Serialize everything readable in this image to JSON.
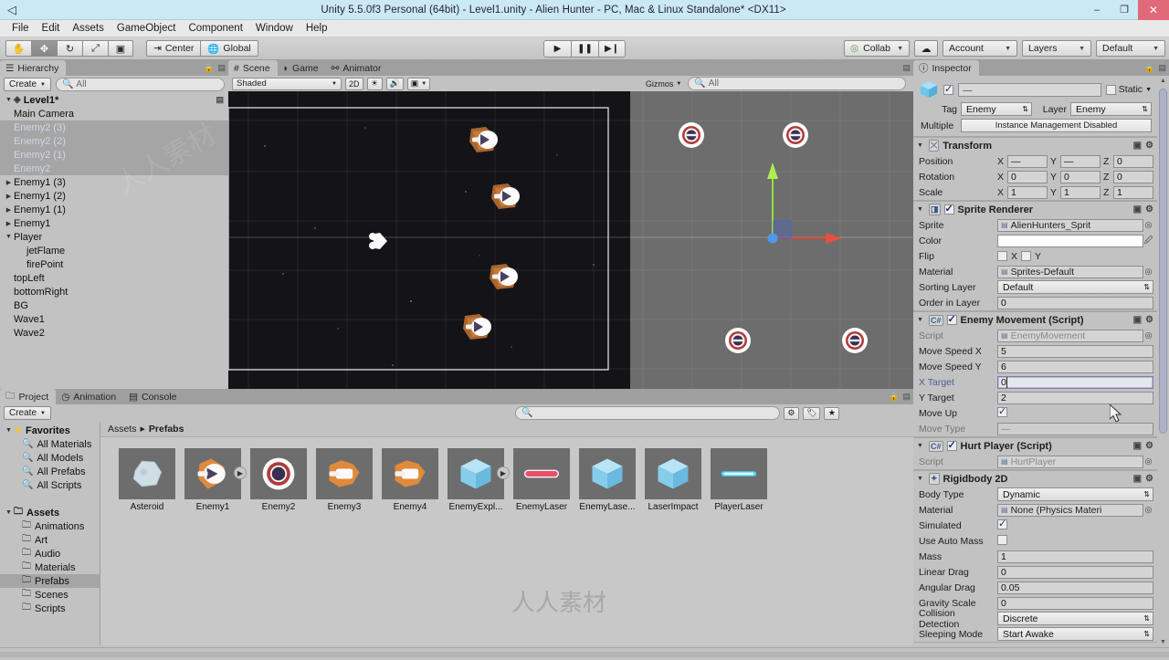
{
  "titlebar": {
    "title": "Unity 5.5.0f3 Personal (64bit) - Level1.unity - Alien Hunter - PC, Mac & Linux Standalone* <DX11>",
    "logo_icon": "unity-logo-icon",
    "minimize": "–",
    "maximize": "❐",
    "close": "✕"
  },
  "menubar": {
    "items": [
      "File",
      "Edit",
      "Assets",
      "GameObject",
      "Component",
      "Window",
      "Help"
    ]
  },
  "toolbar": {
    "transform_tools": [
      {
        "name": "hand-tool",
        "glyph": "✋",
        "active": false
      },
      {
        "name": "move-tool",
        "glyph": "✥",
        "active": true
      },
      {
        "name": "rotate-tool",
        "glyph": "↻",
        "active": false
      },
      {
        "name": "scale-tool",
        "glyph": "⤢",
        "active": false
      },
      {
        "name": "rect-tool",
        "glyph": "▣",
        "active": false
      }
    ],
    "pivot_label": "Center",
    "pivot_icon": "pivot-icon",
    "handle_label": "Global",
    "handle_icon": "globe-icon",
    "play": "▶",
    "pause": "❚❚",
    "step": "▶❙",
    "collab_label": "Collab",
    "collab_icon": "collab-check-icon",
    "cloud_icon": "cloud-icon",
    "account_label": "Account",
    "layers_label": "Layers",
    "layout_label": "Default"
  },
  "hierarchy": {
    "tab": "Hierarchy",
    "tab_icon": "hierarchy-icon",
    "create_label": "Create",
    "search_placeholder": "All",
    "search_icon": "search-icon",
    "scene_name": "Level1*",
    "items": [
      {
        "label": "Main Camera",
        "depth": 1,
        "arrow": "",
        "selected": false,
        "dim": false
      },
      {
        "label": "Enemy2 (3)",
        "depth": 1,
        "arrow": "",
        "selected": true,
        "dim": true
      },
      {
        "label": "Enemy2 (2)",
        "depth": 1,
        "arrow": "",
        "selected": true,
        "dim": true
      },
      {
        "label": "Enemy2 (1)",
        "depth": 1,
        "arrow": "",
        "selected": true,
        "dim": true
      },
      {
        "label": "Enemy2",
        "depth": 1,
        "arrow": "",
        "selected": true,
        "dim": true
      },
      {
        "label": "Enemy1 (3)",
        "depth": 1,
        "arrow": "▶",
        "selected": false,
        "dim": false
      },
      {
        "label": "Enemy1 (2)",
        "depth": 1,
        "arrow": "▶",
        "selected": false,
        "dim": false
      },
      {
        "label": "Enemy1 (1)",
        "depth": 1,
        "arrow": "▶",
        "selected": false,
        "dim": false
      },
      {
        "label": "Enemy1",
        "depth": 1,
        "arrow": "▶",
        "selected": false,
        "dim": false
      },
      {
        "label": "Player",
        "depth": 1,
        "arrow": "▼",
        "selected": false,
        "dim": false
      },
      {
        "label": "jetFlame",
        "depth": 2,
        "arrow": "",
        "selected": false,
        "dim": false
      },
      {
        "label": "firePoint",
        "depth": 2,
        "arrow": "",
        "selected": false,
        "dim": false
      },
      {
        "label": "topLeft",
        "depth": 1,
        "arrow": "",
        "selected": false,
        "dim": false
      },
      {
        "label": "bottomRight",
        "depth": 1,
        "arrow": "",
        "selected": false,
        "dim": false
      },
      {
        "label": "BG",
        "depth": 1,
        "arrow": "",
        "selected": false,
        "dim": false
      },
      {
        "label": "Wave1",
        "depth": 1,
        "arrow": "",
        "selected": false,
        "dim": false
      },
      {
        "label": "Wave2",
        "depth": 1,
        "arrow": "",
        "selected": false,
        "dim": false
      }
    ]
  },
  "scene": {
    "tabs": [
      {
        "label": "Scene",
        "icon": "scene-hash-icon",
        "selected": true
      },
      {
        "label": "Game",
        "icon": "game-pad-icon",
        "selected": false
      },
      {
        "label": "Animator",
        "icon": "animator-icon",
        "selected": false
      }
    ],
    "draw_mode": "Shaded",
    "mode_2d": "2D",
    "light_icon": "lighting-icon",
    "audio_icon": "audio-icon",
    "fx_icon": "effects-icon",
    "gizmos_label": "Gizmos",
    "search_placeholder": "All",
    "gizmo_axes": {
      "x": "x-axis-handle",
      "y": "y-axis-handle",
      "center": "center-handle"
    }
  },
  "project": {
    "tabs": [
      {
        "label": "Project",
        "icon": "folder-icon",
        "selected": true
      },
      {
        "label": "Animation",
        "icon": "clock-icon",
        "selected": false
      },
      {
        "label": "Console",
        "icon": "console-icon",
        "selected": false
      }
    ],
    "create_label": "Create",
    "search_placeholder": "",
    "search_icon": "search-icon",
    "filter_icons": [
      "type-filter-icon",
      "label-filter-icon",
      "favorite-filter-icon"
    ],
    "breadcrumb": [
      "Assets",
      "Prefabs"
    ],
    "tree": [
      {
        "label": "Favorites",
        "depth": 0,
        "arrow": "▼",
        "icon": "star-icon",
        "bold": true,
        "sel": false
      },
      {
        "label": "All Materials",
        "depth": 1,
        "arrow": "",
        "icon": "search-icon",
        "bold": false,
        "sel": false
      },
      {
        "label": "All Models",
        "depth": 1,
        "arrow": "",
        "icon": "search-icon",
        "bold": false,
        "sel": false
      },
      {
        "label": "All Prefabs",
        "depth": 1,
        "arrow": "",
        "icon": "search-icon",
        "bold": false,
        "sel": false
      },
      {
        "label": "All Scripts",
        "depth": 1,
        "arrow": "",
        "icon": "search-icon",
        "bold": false,
        "sel": false
      },
      {
        "label": "",
        "depth": 0,
        "arrow": "",
        "icon": "",
        "bold": false,
        "sel": false
      },
      {
        "label": "Assets",
        "depth": 0,
        "arrow": "▼",
        "icon": "folder-icon",
        "bold": true,
        "sel": false
      },
      {
        "label": "Animations",
        "depth": 1,
        "arrow": "",
        "icon": "folder-icon",
        "bold": false,
        "sel": false
      },
      {
        "label": "Art",
        "depth": 1,
        "arrow": "",
        "icon": "folder-icon",
        "bold": false,
        "sel": false
      },
      {
        "label": "Audio",
        "depth": 1,
        "arrow": "",
        "icon": "folder-icon",
        "bold": false,
        "sel": false
      },
      {
        "label": "Materials",
        "depth": 1,
        "arrow": "",
        "icon": "folder-icon",
        "bold": false,
        "sel": false
      },
      {
        "label": "Prefabs",
        "depth": 1,
        "arrow": "",
        "icon": "folder-icon",
        "bold": false,
        "sel": true
      },
      {
        "label": "Scenes",
        "depth": 1,
        "arrow": "",
        "icon": "folder-icon",
        "bold": false,
        "sel": false
      },
      {
        "label": "Scripts",
        "depth": 1,
        "arrow": "",
        "icon": "folder-icon",
        "bold": false,
        "sel": false
      }
    ],
    "assets": [
      {
        "label": "Asteroid",
        "kind": "asteroid"
      },
      {
        "label": "Enemy1",
        "kind": "enemy1"
      },
      {
        "label": "Enemy2",
        "kind": "enemy2"
      },
      {
        "label": "Enemy3",
        "kind": "enemy3"
      },
      {
        "label": "Enemy4",
        "kind": "enemy3"
      },
      {
        "label": "EnemyExpl...",
        "kind": "cube"
      },
      {
        "label": "EnemyLaser",
        "kind": "redlaser"
      },
      {
        "label": "EnemyLase...",
        "kind": "cube"
      },
      {
        "label": "LaserImpact",
        "kind": "cube"
      },
      {
        "label": "PlayerLaser",
        "kind": "bluelaser"
      }
    ]
  },
  "inspector": {
    "tab": "Inspector",
    "tab_icon": "inspector-icon",
    "object_name": "—",
    "enabled": true,
    "static_label": "Static",
    "tag_label": "Tag",
    "tag_value": "Enemy",
    "layer_label": "Layer",
    "layer_value": "Enemy",
    "multiple_label": "Multiple",
    "prefab_button": "Instance Management Disabled",
    "components": [
      {
        "name": "Transform",
        "icon": "transform-icon",
        "has_checkbox": false,
        "rows": [
          {
            "type": "vec3",
            "label": "Position",
            "x": "—",
            "y": "—",
            "z": "0"
          },
          {
            "type": "vec3",
            "label": "Rotation",
            "x": "0",
            "y": "0",
            "z": "0"
          },
          {
            "type": "vec3",
            "label": "Scale",
            "x": "1",
            "y": "1",
            "z": "1"
          }
        ]
      },
      {
        "name": "Sprite Renderer",
        "icon": "sprite-renderer-icon",
        "has_checkbox": true,
        "checked": true,
        "rows": [
          {
            "type": "object",
            "label": "Sprite",
            "value": "AlienHunters_Sprit",
            "obj_icon": "sprite-icon"
          },
          {
            "type": "color",
            "label": "Color",
            "value": "#ffffff"
          },
          {
            "type": "flip",
            "label": "Flip",
            "x_label": "X",
            "y_label": "Y",
            "x": false,
            "y": false
          },
          {
            "type": "object",
            "label": "Material",
            "value": "Sprites-Default",
            "obj_icon": "material-icon"
          },
          {
            "type": "dropdown",
            "label": "Sorting Layer",
            "value": "Default"
          },
          {
            "type": "text",
            "label": "Order in Layer",
            "value": "0"
          }
        ]
      },
      {
        "name": "Enemy Movement (Script)",
        "icon": "script-icon",
        "has_checkbox": true,
        "checked": true,
        "rows": [
          {
            "type": "object",
            "label": "Script",
            "value": "EnemyMovement",
            "dim": true,
            "obj_icon": "cs-script-icon"
          },
          {
            "type": "text",
            "label": "Move Speed X",
            "value": "5"
          },
          {
            "type": "text",
            "label": "Move Speed Y",
            "value": "6"
          },
          {
            "type": "text",
            "label": "X Target",
            "value": "0",
            "focused": true,
            "label_blue": true
          },
          {
            "type": "text",
            "label": "Y Target",
            "value": "2"
          },
          {
            "type": "checkbox",
            "label": "Move Up",
            "value": true
          },
          {
            "type": "text",
            "label": "Move Type",
            "value": "—",
            "dim": true
          }
        ]
      },
      {
        "name": "Hurt Player (Script)",
        "icon": "script-icon",
        "has_checkbox": true,
        "checked": true,
        "rows": [
          {
            "type": "object",
            "label": "Script",
            "value": "HurtPlayer",
            "dim": true,
            "obj_icon": "cs-script-icon"
          }
        ]
      },
      {
        "name": "Rigidbody 2D",
        "icon": "rigidbody-icon",
        "has_checkbox": false,
        "rows": [
          {
            "type": "dropdown",
            "label": "Body Type",
            "value": "Dynamic"
          },
          {
            "type": "object",
            "label": "Material",
            "value": "None (Physics Materi"
          },
          {
            "type": "checkbox",
            "label": "Simulated",
            "value": true
          },
          {
            "type": "checkbox",
            "label": "Use Auto Mass",
            "value": false
          },
          {
            "type": "text",
            "label": "Mass",
            "value": "1"
          },
          {
            "type": "text",
            "label": "Linear Drag",
            "value": "0"
          },
          {
            "type": "text",
            "label": "Angular Drag",
            "value": "0.05"
          },
          {
            "type": "text",
            "label": "Gravity Scale",
            "value": "0"
          },
          {
            "type": "dropdown",
            "label": "Collision Detection",
            "value": "Discrete"
          },
          {
            "type": "dropdown",
            "label": "Sleeping Mode",
            "value": "Start Awake"
          }
        ]
      }
    ]
  }
}
